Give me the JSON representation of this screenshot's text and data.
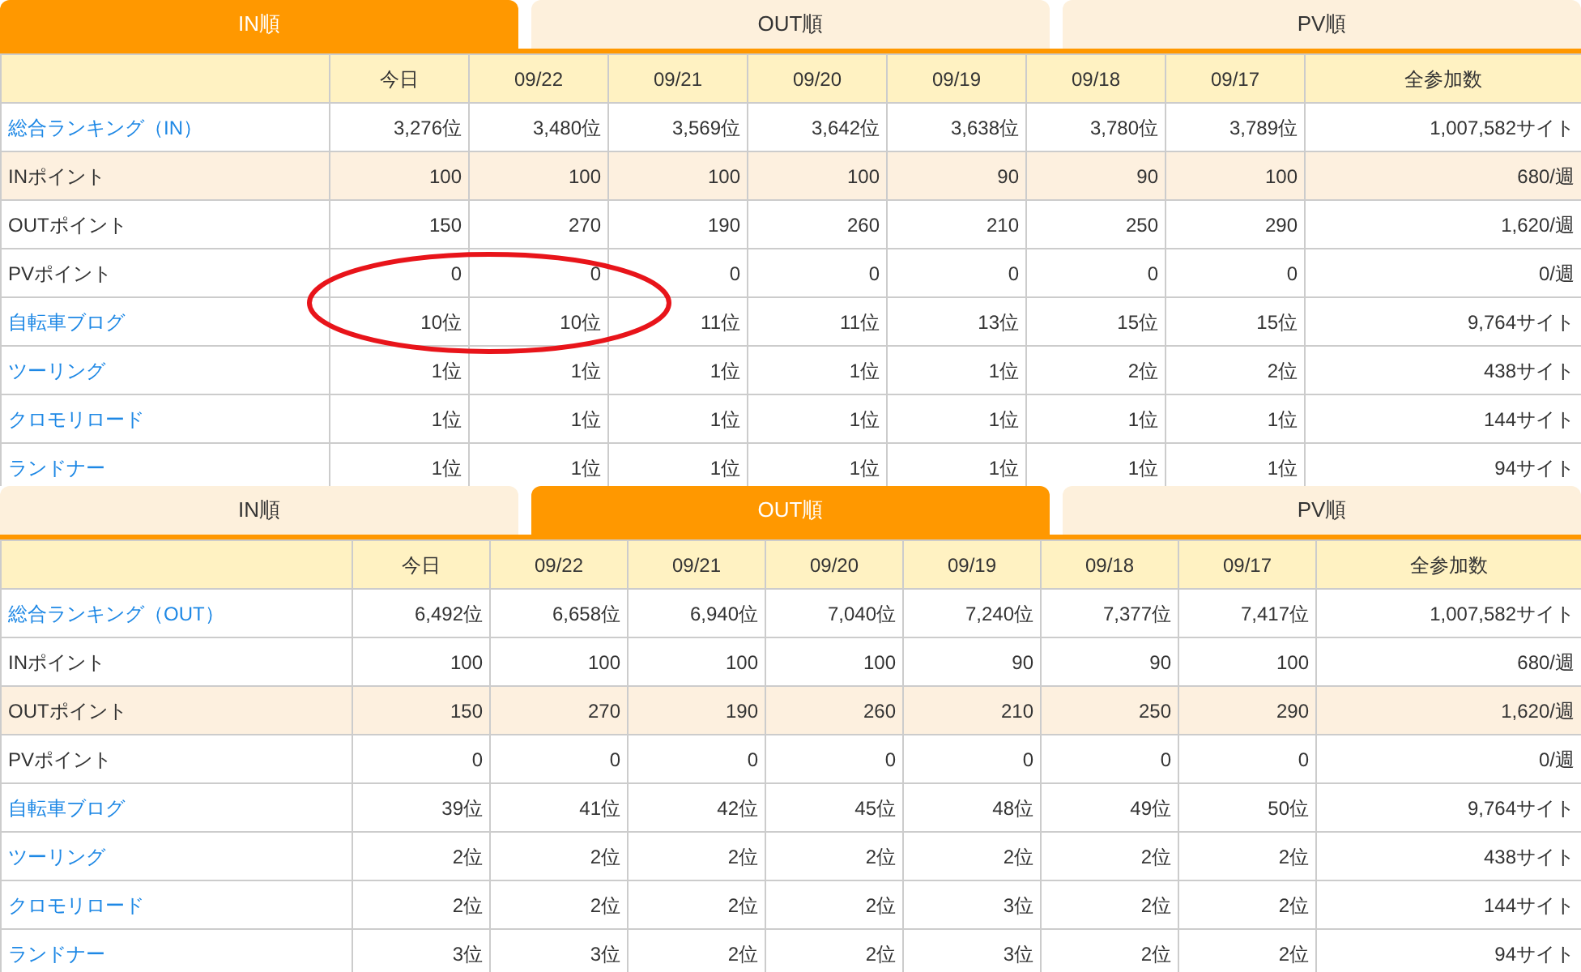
{
  "panels": [
    {
      "tabs": [
        {
          "label": "IN順",
          "selected": true
        },
        {
          "label": "OUT順",
          "selected": false
        },
        {
          "label": "PV順",
          "selected": false
        }
      ],
      "annotation": {
        "kind": "ellipse"
      },
      "columns": [
        "今日",
        "09/22",
        "09/21",
        "09/20",
        "09/19",
        "09/18",
        "09/17",
        "全参加数"
      ],
      "rows": [
        {
          "label": "総合ランキング（IN）",
          "kind": "link",
          "highlighted": false,
          "cells": [
            "3,276位",
            "3,480位",
            "3,569位",
            "3,642位",
            "3,638位",
            "3,780位",
            "3,789位",
            "1,007,582サイト"
          ]
        },
        {
          "label": "INポイント",
          "kind": "plain",
          "highlighted": true,
          "cells": [
            "100",
            "100",
            "100",
            "100",
            "90",
            "90",
            "100",
            "680/週"
          ]
        },
        {
          "label": "OUTポイント",
          "kind": "plain",
          "highlighted": false,
          "cells": [
            "150",
            "270",
            "190",
            "260",
            "210",
            "250",
            "290",
            "1,620/週"
          ]
        },
        {
          "label": "PVポイント",
          "kind": "plain",
          "highlighted": false,
          "cells": [
            "0",
            "0",
            "0",
            "0",
            "0",
            "0",
            "0",
            "0/週"
          ]
        },
        {
          "label": "自転車ブログ",
          "kind": "link",
          "highlighted": false,
          "cells": [
            "10位",
            "10位",
            "11位",
            "11位",
            "13位",
            "15位",
            "15位",
            "9,764サイト"
          ]
        },
        {
          "label": "ツーリング",
          "kind": "link",
          "highlighted": false,
          "cells": [
            "1位",
            "1位",
            "1位",
            "1位",
            "1位",
            "2位",
            "2位",
            "438サイト"
          ]
        },
        {
          "label": "クロモリロード",
          "kind": "link",
          "highlighted": false,
          "cells": [
            "1位",
            "1位",
            "1位",
            "1位",
            "1位",
            "1位",
            "1位",
            "144サイト"
          ]
        },
        {
          "label": "ランドナー",
          "kind": "link",
          "highlighted": false,
          "cells": [
            "1位",
            "1位",
            "1位",
            "1位",
            "1位",
            "1位",
            "1位",
            "94サイト"
          ]
        }
      ]
    },
    {
      "tabs": [
        {
          "label": "IN順",
          "selected": false
        },
        {
          "label": "OUT順",
          "selected": true
        },
        {
          "label": "PV順",
          "selected": false
        }
      ],
      "columns": [
        "今日",
        "09/22",
        "09/21",
        "09/20",
        "09/19",
        "09/18",
        "09/17",
        "全参加数"
      ],
      "rows": [
        {
          "label": "総合ランキング（OUT）",
          "kind": "link",
          "highlighted": false,
          "cells": [
            "6,492位",
            "6,658位",
            "6,940位",
            "7,040位",
            "7,240位",
            "7,377位",
            "7,417位",
            "1,007,582サイト"
          ]
        },
        {
          "label": "INポイント",
          "kind": "plain",
          "highlighted": false,
          "cells": [
            "100",
            "100",
            "100",
            "100",
            "90",
            "90",
            "100",
            "680/週"
          ]
        },
        {
          "label": "OUTポイント",
          "kind": "plain",
          "highlighted": true,
          "cells": [
            "150",
            "270",
            "190",
            "260",
            "210",
            "250",
            "290",
            "1,620/週"
          ]
        },
        {
          "label": "PVポイント",
          "kind": "plain",
          "highlighted": false,
          "cells": [
            "0",
            "0",
            "0",
            "0",
            "0",
            "0",
            "0",
            "0/週"
          ]
        },
        {
          "label": "自転車ブログ",
          "kind": "link",
          "highlighted": false,
          "cells": [
            "39位",
            "41位",
            "42位",
            "45位",
            "48位",
            "49位",
            "50位",
            "9,764サイト"
          ]
        },
        {
          "label": "ツーリング",
          "kind": "link",
          "highlighted": false,
          "cells": [
            "2位",
            "2位",
            "2位",
            "2位",
            "2位",
            "2位",
            "2位",
            "438サイト"
          ]
        },
        {
          "label": "クロモリロード",
          "kind": "link",
          "highlighted": false,
          "cells": [
            "2位",
            "2位",
            "2位",
            "2位",
            "3位",
            "2位",
            "2位",
            "144サイト"
          ]
        },
        {
          "label": "ランドナー",
          "kind": "link",
          "highlighted": false,
          "cells": [
            "3位",
            "3位",
            "2位",
            "2位",
            "3位",
            "2位",
            "2位",
            "94サイト"
          ]
        }
      ]
    }
  ]
}
